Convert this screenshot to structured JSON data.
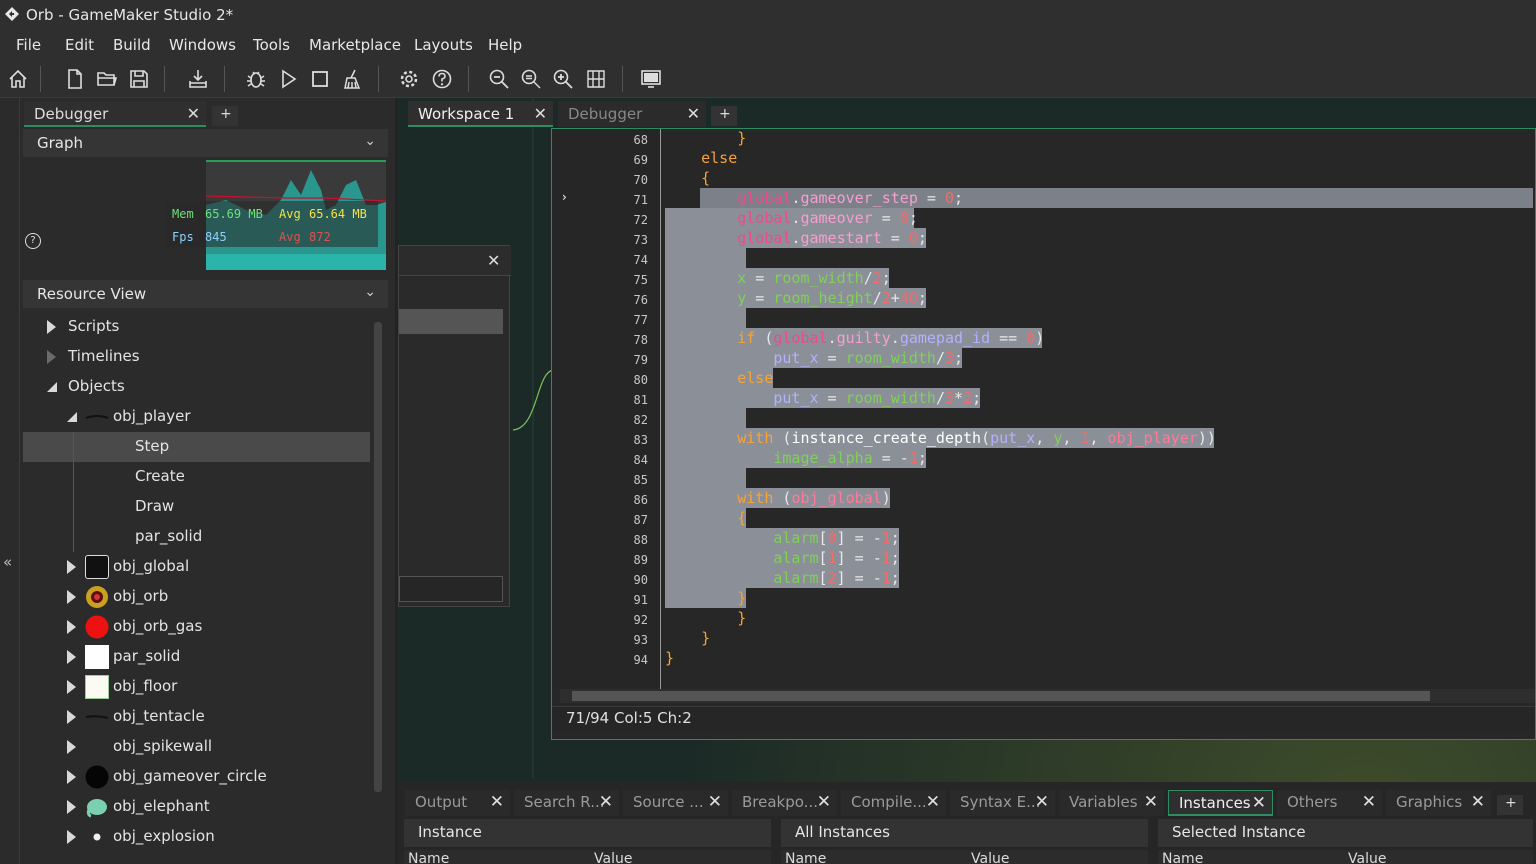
{
  "window": {
    "title": "Orb - GameMaker Studio 2*"
  },
  "menu": [
    "File",
    "Edit",
    "Build",
    "Windows",
    "Tools",
    "Marketplace",
    "Layouts",
    "Help"
  ],
  "toolbar": {
    "icons": [
      "home-icon",
      "new-icon",
      "open-icon",
      "save-icon",
      "export-icon",
      "debug-icon",
      "run-icon",
      "stop-icon",
      "clean-icon",
      "settings-icon",
      "help-icon",
      "zoom-out-icon",
      "zoom-reset-icon",
      "zoom-in-icon",
      "fit-icon",
      "device-icon"
    ]
  },
  "left": {
    "tab_label": "Debugger",
    "tab_add": "+",
    "graph_header": "Graph",
    "mem_label": "Mem",
    "mem_value": "65.69 MB",
    "mem_avg_label": "Avg",
    "mem_avg": "65.64 MB",
    "fps_label": "Fps",
    "fps_value": "845",
    "fps_avg_label": "Avg",
    "fps_avg": "872",
    "help": "?",
    "resource_header": "Resource View",
    "tree": [
      {
        "label": "Scripts",
        "type": "folder"
      },
      {
        "label": "Timelines",
        "type": "folder-empty"
      },
      {
        "label": "Objects",
        "type": "folder-open"
      },
      {
        "label": "obj_player",
        "type": "object-open"
      },
      {
        "label": "Step",
        "type": "event",
        "selected": true
      },
      {
        "label": "Create",
        "type": "event"
      },
      {
        "label": "Draw",
        "type": "event"
      },
      {
        "label": "par_solid",
        "type": "event"
      },
      {
        "label": "obj_global",
        "type": "object"
      },
      {
        "label": "obj_orb",
        "type": "object"
      },
      {
        "label": "obj_orb_gas",
        "type": "object"
      },
      {
        "label": "par_solid",
        "type": "object"
      },
      {
        "label": "obj_floor",
        "type": "object"
      },
      {
        "label": "obj_tentacle",
        "type": "object"
      },
      {
        "label": "obj_spikewall",
        "type": "object"
      },
      {
        "label": "obj_gameover_circle",
        "type": "object"
      },
      {
        "label": "obj_elephant",
        "type": "object"
      },
      {
        "label": "obj_explosion",
        "type": "object"
      }
    ]
  },
  "workspace": {
    "tabs": [
      {
        "label": "Workspace 1",
        "active": true
      },
      {
        "label": "Debugger",
        "active": false
      }
    ],
    "tab_add": "+",
    "status": "71/94 Col:5 Ch:2",
    "line_numbers": [
      "68",
      "69",
      "70",
      "71",
      "72",
      "73",
      "74",
      "75",
      "76",
      "77",
      "78",
      "79",
      "80",
      "81",
      "82",
      "83",
      "84",
      "85",
      "86",
      "87",
      "88",
      "89",
      "90",
      "91",
      "92",
      "93",
      "94"
    ]
  },
  "bottom": {
    "tabs": [
      "Output",
      "Search R...",
      "Source ...",
      "Breakpo...",
      "Compile...",
      "Syntax E...",
      "Variables",
      "Instances",
      "Others",
      "Graphics"
    ],
    "active_tab": "Instances",
    "tab_add": "+",
    "panels": [
      "Instance",
      "All Instances",
      "Selected Instance"
    ],
    "col_name": "Name",
    "col_value": "Value"
  },
  "colors": {
    "accent": "#2e8c63",
    "selection": "#8b8f98",
    "keyword": "#f5a33a"
  }
}
